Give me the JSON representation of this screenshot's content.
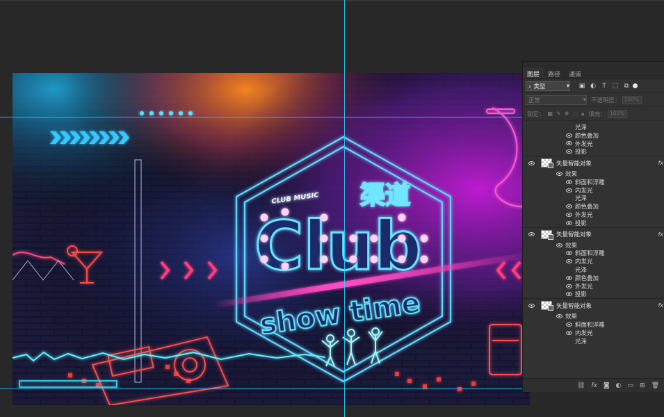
{
  "canvas_title": {
    "top_chinese": "渠道",
    "brand_small": "CLUB MUSIC",
    "main": "Club",
    "sub": "show time"
  },
  "layers_panel": {
    "tabs": [
      "图层",
      "路径",
      "通道"
    ],
    "filter_label": "类型",
    "blend_mode": "正常",
    "opacity_label": "不透明度：",
    "opacity_value": "100%",
    "lock_label": "锁定：",
    "fill_label": "填充：",
    "fill_value": "100%",
    "top_effects": [
      "光泽",
      "颜色叠加",
      "外发光",
      "投影"
    ],
    "layers": [
      {
        "name": "矢量智能对象",
        "fx": "fx",
        "effects_label": "效果",
        "effects": [
          "斜面和浮雕",
          "内发光",
          "光泽",
          "颜色叠加",
          "外发光",
          "投影"
        ]
      },
      {
        "name": "矢量智能对象",
        "fx": "fx",
        "effects_label": "效果",
        "effects": [
          "斜面和浮雕",
          "内发光",
          "光泽",
          "颜色叠加",
          "外发光",
          "投影"
        ]
      },
      {
        "name": "矢量智能对象",
        "fx": "fx",
        "effects_label": "效果",
        "effects": [
          "斜面和浮雕",
          "内发光",
          "光泽"
        ]
      }
    ],
    "footer_icons": [
      "link-icon",
      "fx-icon",
      "mask-icon",
      "adjustment-icon",
      "group-icon",
      "new-layer-icon",
      "trash-icon"
    ]
  },
  "colors": {
    "workspace": "#282828",
    "panel": "#323232",
    "guide": "#22d6ff",
    "neon_cyan": "#4fe8ff",
    "neon_pink": "#ff3cb4",
    "neon_red": "#ff4a4a"
  }
}
